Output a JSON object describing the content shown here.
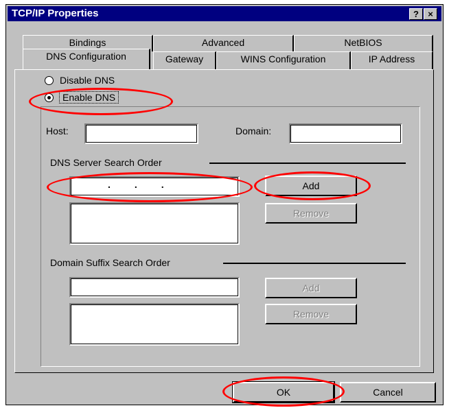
{
  "window": {
    "title": "TCP/IP Properties",
    "help_glyph": "?",
    "close_glyph": "×"
  },
  "tabs": {
    "row1": [
      "Bindings",
      "Advanced",
      "NetBIOS"
    ],
    "row2": [
      "DNS Configuration",
      "Gateway",
      "WINS Configuration",
      "IP Address"
    ]
  },
  "dns": {
    "disable_label": "Disable DNS",
    "enable_label": "Enable DNS",
    "host_label": "Host:",
    "domain_label": "Domain:",
    "host_value": "",
    "domain_value": ""
  },
  "server_order": {
    "title": "DNS Server Search Order",
    "ip_dots": ".         .         .",
    "add_label": "Add",
    "remove_label": "Remove"
  },
  "suffix_order": {
    "title": "Domain Suffix Search Order",
    "add_label": "Add",
    "remove_label": "Remove"
  },
  "footer": {
    "ok_label": "OK",
    "cancel_label": "Cancel"
  },
  "colors": {
    "titlebar": "#000080",
    "face": "#c0c0c0",
    "highlight": "#ff0000"
  }
}
